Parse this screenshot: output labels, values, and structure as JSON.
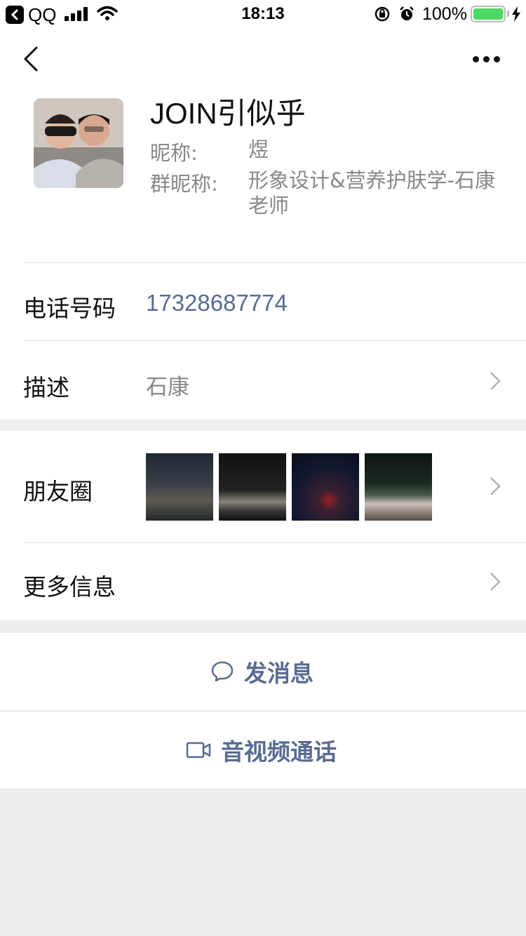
{
  "status_bar": {
    "app": "QQ",
    "time": "18:13",
    "battery_pct": "100%",
    "battery_level": 1.0,
    "battery_color": "#4cd964"
  },
  "header": {
    "back_icon": "chevron-left-icon",
    "more_icon": "ellipsis-icon"
  },
  "profile": {
    "name": "JOIN引似乎",
    "nickname_label": "昵称:",
    "nickname": "煜",
    "group_nickname_label": "群昵称:",
    "group_nickname": "形象设计&营养护肤学-石康老师"
  },
  "rows": {
    "phone_label": "电话号码",
    "phone": "17328687774",
    "desc_label": "描述",
    "desc": "石康",
    "moments_label": "朋友圈",
    "more_label": "更多信息"
  },
  "actions": {
    "message_label": "发消息",
    "call_label": "音视频通话"
  },
  "colors": {
    "accent": "#576b95",
    "background": "#ededed",
    "muted_text": "#888888"
  }
}
